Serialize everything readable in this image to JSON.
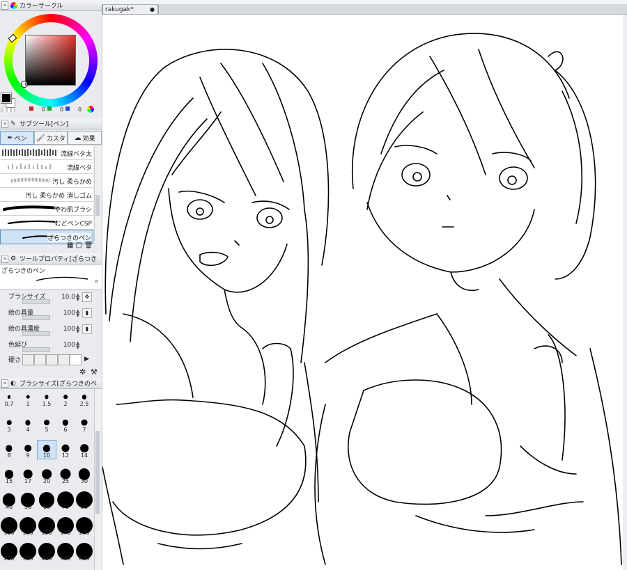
{
  "panels": {
    "color_circle": {
      "title": "カラーサークル",
      "r": "0",
      "g": "0",
      "b": "0"
    },
    "subtool": {
      "title": "サブツール[ペン]",
      "tabs": [
        {
          "label": "ペン"
        },
        {
          "label": "カスタ"
        },
        {
          "label": "効果"
        }
      ],
      "brushes": [
        {
          "label": "流線ベタ太"
        },
        {
          "label": "流線ベタ"
        },
        {
          "label": "汚し 柔らかめ"
        },
        {
          "label": "汚し 柔らかめ 消しゴム"
        },
        {
          "label": "やわ肌ブラシ"
        },
        {
          "label": "むどペンCSP"
        },
        {
          "label": "ざらつきのペン"
        }
      ]
    },
    "tool_property": {
      "title": "ツールプロパティ[ざらつき",
      "preset_name": "ざらつきのペン",
      "props": [
        {
          "label": "ブラシサイズ",
          "value": "10.0"
        },
        {
          "label": "絵の具量",
          "value": "100"
        },
        {
          "label": "絵の具濃度",
          "value": "100"
        },
        {
          "label": "色延び",
          "value": "100"
        },
        {
          "label": "硬さ",
          "value": ""
        }
      ]
    },
    "brush_size": {
      "title": "ブラシサイズ[ざらつきのペ",
      "sizes": [
        "0.7",
        "1",
        "1.5",
        "2",
        "2.5",
        "3",
        "4",
        "5",
        "6",
        "7",
        "8",
        "9",
        "10",
        "12",
        "14",
        "15",
        "17",
        "20",
        "25",
        "30",
        "40",
        "50",
        "60",
        "70",
        "80",
        "100",
        "120",
        "150",
        "170",
        "200",
        "250",
        "300",
        "400",
        "500",
        "600"
      ],
      "selected": "10"
    }
  },
  "document": {
    "tab_title": "rakugak*",
    "close_glyph": "●"
  },
  "colors": {
    "accent": "#5b8fc7",
    "panel_bg": "#e9ebee",
    "selected": "#cfe3f6"
  }
}
